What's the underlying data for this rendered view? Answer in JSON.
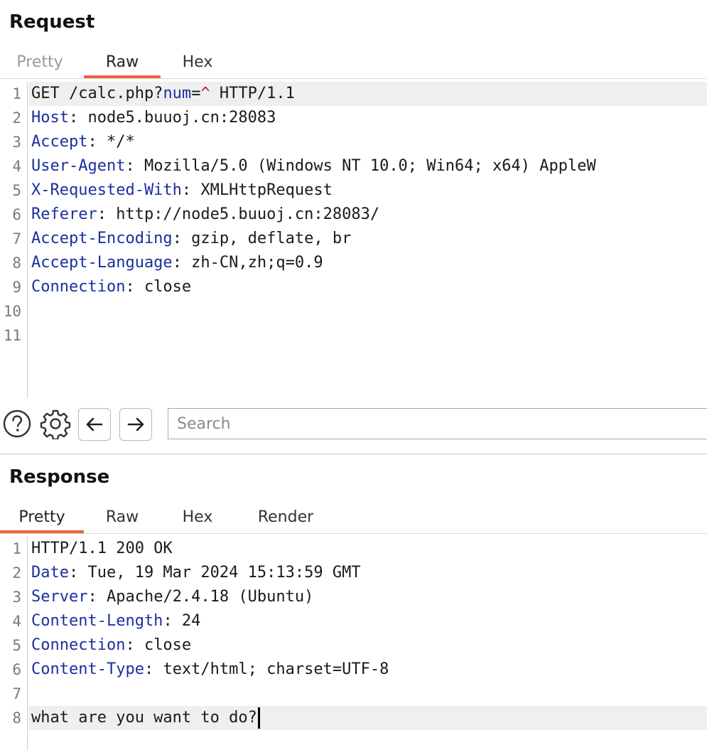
{
  "request": {
    "title": "Request",
    "tabs": [
      {
        "label": "Pretty"
      },
      {
        "label": "Raw"
      },
      {
        "label": "Hex"
      }
    ],
    "active_tab": "Raw",
    "lines": [
      {
        "n": "1",
        "parts": [
          {
            "t": "GET /calc.php?",
            "c": "v"
          },
          {
            "t": "num",
            "c": "k"
          },
          {
            "t": "=",
            "c": "v"
          },
          {
            "t": "^",
            "c": "hl-red"
          },
          {
            "t": " HTTP/1.1",
            "c": "v"
          }
        ]
      },
      {
        "n": "2",
        "parts": [
          {
            "t": "Host",
            "c": "k"
          },
          {
            "t": ": node5.buuoj.cn:28083",
            "c": "v"
          }
        ]
      },
      {
        "n": "3",
        "parts": [
          {
            "t": "Accept",
            "c": "k"
          },
          {
            "t": ": */*",
            "c": "v"
          }
        ]
      },
      {
        "n": "4",
        "parts": [
          {
            "t": "User-Agent",
            "c": "k"
          },
          {
            "t": ": Mozilla/5.0 (Windows NT 10.0; Win64; x64) AppleW",
            "c": "v"
          }
        ]
      },
      {
        "n": "5",
        "parts": [
          {
            "t": "X-Requested-With",
            "c": "k"
          },
          {
            "t": ": XMLHttpRequest",
            "c": "v"
          }
        ]
      },
      {
        "n": "6",
        "parts": [
          {
            "t": "Referer",
            "c": "k"
          },
          {
            "t": ": http://node5.buuoj.cn:28083/",
            "c": "v"
          }
        ]
      },
      {
        "n": "7",
        "parts": [
          {
            "t": "Accept-Encoding",
            "c": "k"
          },
          {
            "t": ": gzip, deflate, br",
            "c": "v"
          }
        ]
      },
      {
        "n": "8",
        "parts": [
          {
            "t": "Accept-Language",
            "c": "k"
          },
          {
            "t": ": zh-CN,zh;q=0.9",
            "c": "v"
          }
        ]
      },
      {
        "n": "9",
        "parts": [
          {
            "t": "Connection",
            "c": "k"
          },
          {
            "t": ": close",
            "c": "v"
          }
        ]
      },
      {
        "n": "10",
        "parts": []
      },
      {
        "n": "11",
        "parts": []
      }
    ]
  },
  "toolbar": {
    "search_placeholder": "Search"
  },
  "response": {
    "title": "Response",
    "tabs": [
      {
        "label": "Pretty"
      },
      {
        "label": "Raw"
      },
      {
        "label": "Hex"
      },
      {
        "label": "Render"
      }
    ],
    "active_tab": "Pretty",
    "lines": [
      {
        "n": "1",
        "parts": [
          {
            "t": "HTTP/1.1 200 OK",
            "c": "v"
          }
        ]
      },
      {
        "n": "2",
        "parts": [
          {
            "t": "Date",
            "c": "k"
          },
          {
            "t": ": Tue, 19 Mar 2024 15:13:59 GMT",
            "c": "v"
          }
        ]
      },
      {
        "n": "3",
        "parts": [
          {
            "t": "Server",
            "c": "k"
          },
          {
            "t": ": Apache/2.4.18 (Ubuntu)",
            "c": "v"
          }
        ]
      },
      {
        "n": "4",
        "parts": [
          {
            "t": "Content-Length",
            "c": "k"
          },
          {
            "t": ": 24",
            "c": "v"
          }
        ]
      },
      {
        "n": "5",
        "parts": [
          {
            "t": "Connection",
            "c": "k"
          },
          {
            "t": ": close",
            "c": "v"
          }
        ]
      },
      {
        "n": "6",
        "parts": [
          {
            "t": "Content-Type",
            "c": "k"
          },
          {
            "t": ": text/html; charset=UTF-8",
            "c": "v"
          }
        ]
      },
      {
        "n": "7",
        "parts": []
      },
      {
        "n": "8",
        "parts": [
          {
            "t": "what are you want to do?",
            "c": "v"
          }
        ]
      }
    ]
  },
  "colors": {
    "accent_underline": "#e8643a",
    "header_key": "#1a2fa0",
    "highlight_char": "#c8102e",
    "line_highlight_bg": "#efefef"
  },
  "icons": [
    "help-icon",
    "gear-icon",
    "arrow-left-icon",
    "arrow-right-icon"
  ]
}
